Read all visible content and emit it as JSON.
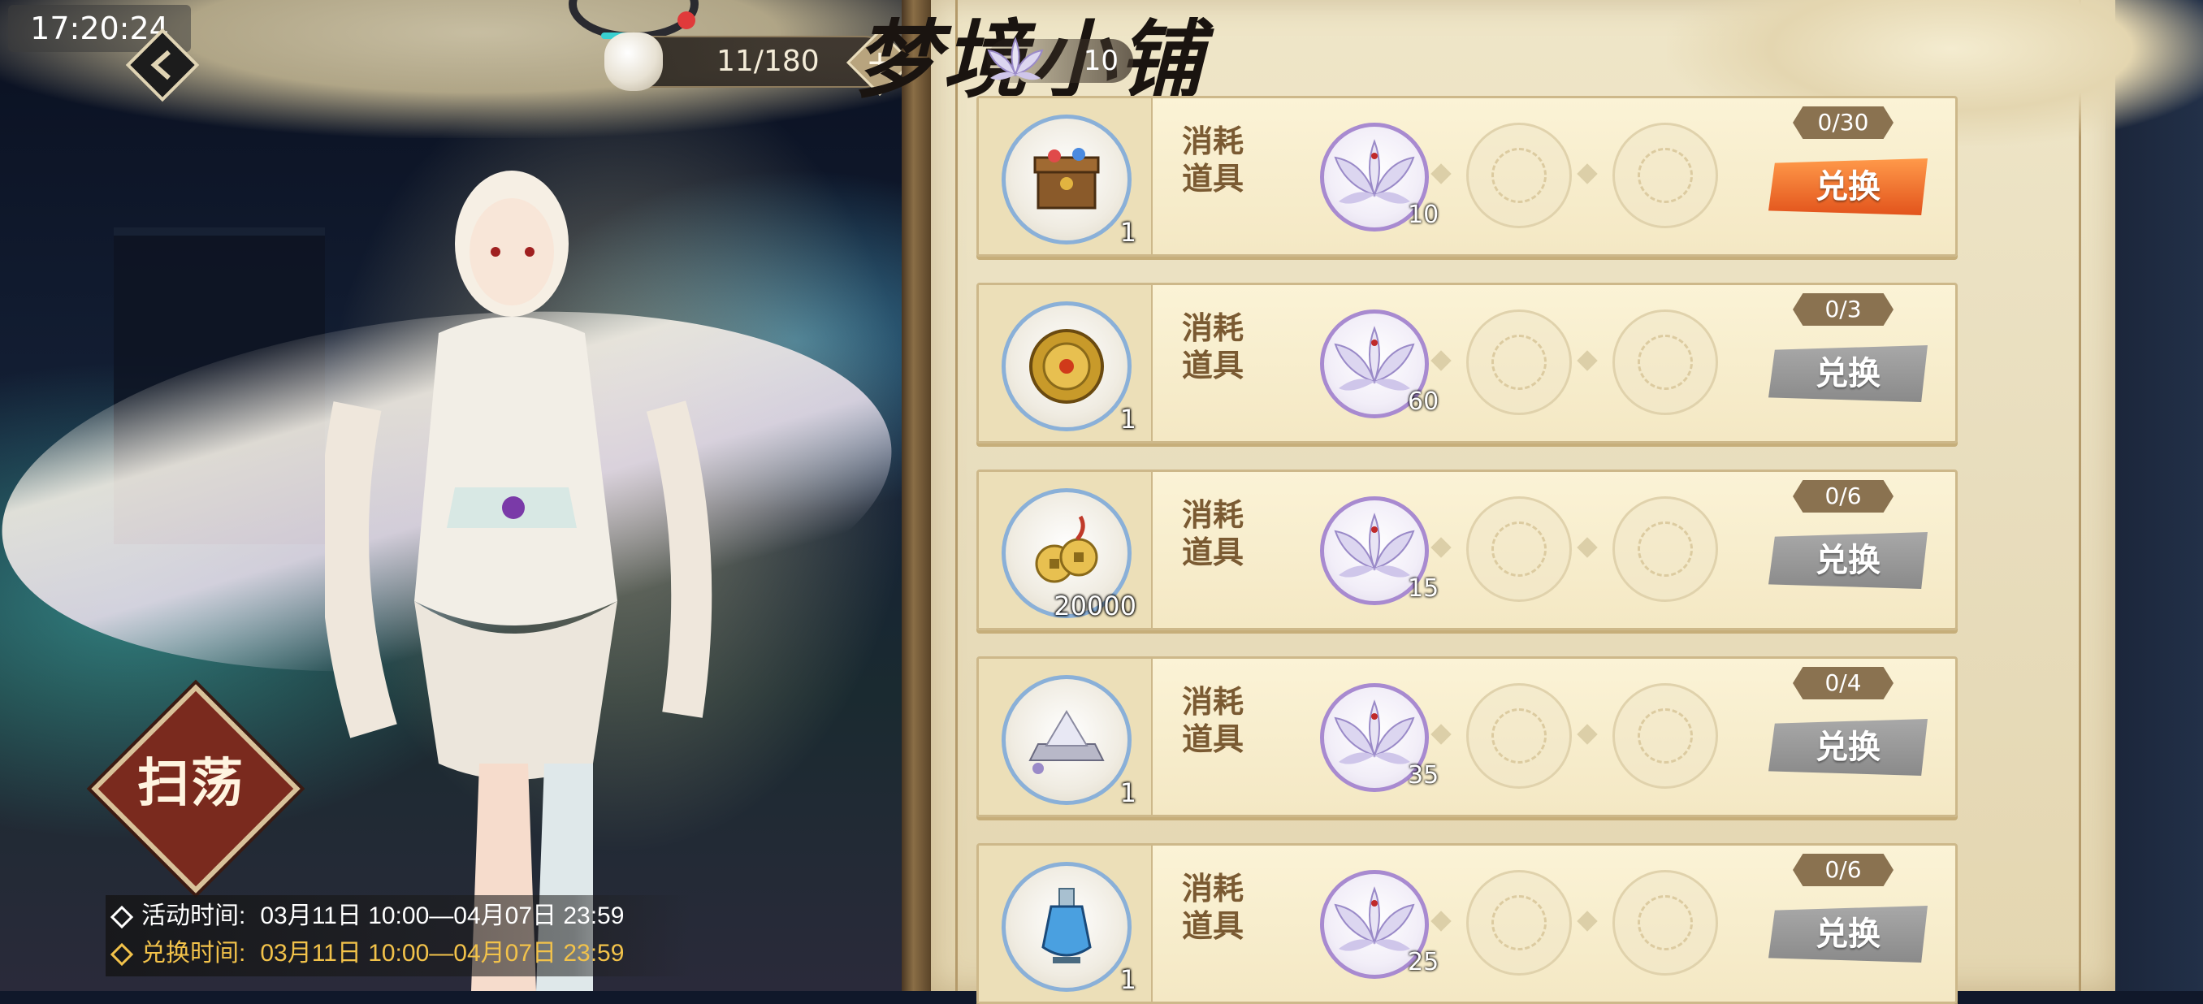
{
  "status_bar": {
    "time": "17:20:24"
  },
  "stamina": {
    "value": "11/180",
    "plus": "+"
  },
  "currency": {
    "icon": "lotus-icon",
    "amount": "10"
  },
  "shop": {
    "title": "梦境小铺"
  },
  "sweep": {
    "label": "扫荡"
  },
  "event_times": {
    "activity_label": "活动时间:",
    "activity_range": "03月11日 10:00—04月07日 23:59",
    "exchange_label": "兑换时间:",
    "exchange_range": "03月11日 10:00—04月07日 23:59"
  },
  "colors": {
    "active_button": "#f0782a",
    "disabled_button": "#9a9a9a",
    "exchange_time_text": "#f2c24a",
    "parchment": "#efe6c8"
  },
  "items": [
    {
      "icon": "treasure-chest-icon",
      "qty": "1",
      "type": "消耗\n道具",
      "cost": "10",
      "limit": "0/30",
      "button": "兑换",
      "active": true
    },
    {
      "icon": "golden-compass-icon",
      "qty": "1",
      "type": "消耗\n道具",
      "cost": "60",
      "limit": "0/3",
      "button": "兑换",
      "active": false
    },
    {
      "icon": "copper-coins-icon",
      "qty": "20000",
      "type": "消耗\n道具",
      "cost": "15",
      "limit": "0/6",
      "button": "兑换",
      "active": false
    },
    {
      "icon": "mountain-stone-icon",
      "qty": "1",
      "type": "消耗\n道具",
      "cost": "35",
      "limit": "0/4",
      "button": "兑换",
      "active": false
    },
    {
      "icon": "blue-potion-icon",
      "qty": "1",
      "type": "消耗\n道具",
      "cost": "25",
      "limit": "0/6",
      "button": "兑换",
      "active": false
    }
  ]
}
